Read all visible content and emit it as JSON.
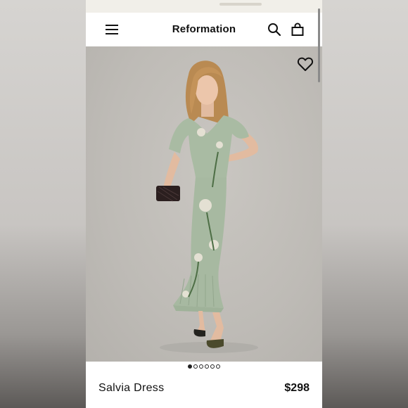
{
  "header": {
    "brand": "Reformation",
    "icons": {
      "menu": "hamburger-menu-icon",
      "search": "search-icon",
      "bag": "shopping-bag-icon"
    }
  },
  "hero": {
    "image": "model-wearing-floral-sage-dress",
    "favorite_icon": "heart-outline-icon"
  },
  "carousel": {
    "total": 6,
    "active": 1
  },
  "product": {
    "name": "Salvia Dress",
    "price": "$298"
  },
  "colors": {
    "accent": "#111111",
    "dress": "#a9bba3",
    "background": "#bebbb6"
  }
}
